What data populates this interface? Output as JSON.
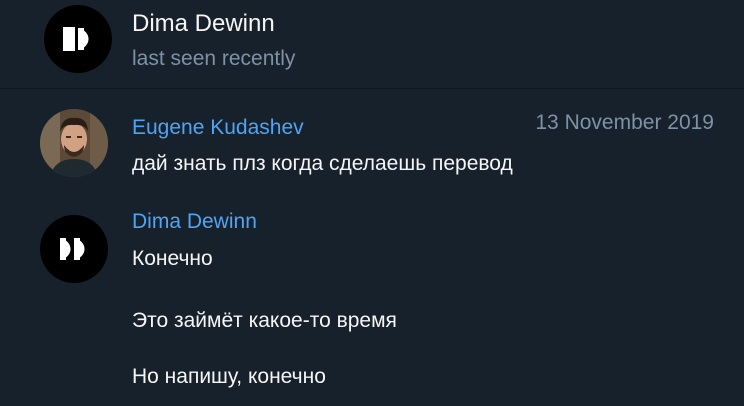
{
  "header": {
    "name": "Dima Dewinn",
    "status": "last seen recently",
    "avatar_icon": "fast-forward-logo"
  },
  "messages": [
    {
      "sender": "Eugene Kudashev",
      "date": "13 November 2019",
      "lines": [
        "дай знать плз когда сделаешь перевод"
      ]
    },
    {
      "sender": "Dima Dewinn",
      "avatar_icon": "fast-forward-logo",
      "lines": [
        "Конечно",
        "Это займёт какое-то время",
        "Но напишу, конечно"
      ]
    }
  ],
  "colors": {
    "background": "#17212b",
    "sender_name": "#4ea4f6",
    "muted": "#7f91a4",
    "text": "#f5f5f5"
  }
}
